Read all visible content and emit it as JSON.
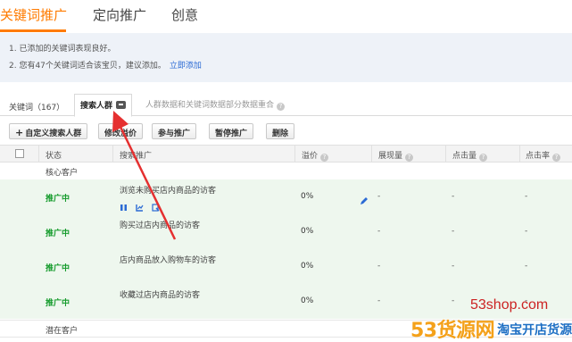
{
  "topnav": {
    "tabs": [
      {
        "label": "关键词推广",
        "active": true
      },
      {
        "label": "定向推广",
        "active": false
      },
      {
        "label": "创意",
        "active": false
      }
    ]
  },
  "tips": {
    "line1": "1. 已添加的关键词表现良好。",
    "line2": "2. 您有47个关键词适合该宝贝，建议添加。",
    "line2_link": "立即添加"
  },
  "subtabs": {
    "keywords": "关键词（167）",
    "crowd": "搜索人群",
    "hint": "人群数据和关键词数据部分数据重合"
  },
  "toolbar": {
    "custom": "自定义搜索人群",
    "edit_bid": "修改溢价",
    "join": "参与推广",
    "pause": "暂停推广",
    "delete": "删除"
  },
  "table": {
    "headers": {
      "status": "状态",
      "crowd": "搜索推广",
      "premium": "溢价",
      "impressions": "展现量",
      "clicks": "点击量",
      "ctr": "点击率"
    },
    "group_core": "核心客户",
    "group_potential": "潜在客户",
    "rows": [
      {
        "status": "推广中",
        "name": "浏览未购买店内商品的访客",
        "premium": "0%",
        "impressions": "-",
        "clicks": "-",
        "ctr": "-"
      },
      {
        "status": "推广中",
        "name": "购买过店内商品的访客",
        "premium": "0%",
        "impressions": "-",
        "clicks": "-",
        "ctr": "-"
      },
      {
        "status": "推广中",
        "name": "店内商品放入购物车的访客",
        "premium": "0%",
        "impressions": "-",
        "clicks": "-",
        "ctr": "-"
      },
      {
        "status": "推广中",
        "name": "收藏过店内商品的访客",
        "premium": "0%",
        "impressions": "-",
        "clicks": "-",
        "ctr": "-"
      }
    ]
  },
  "watermark": {
    "site": "53shop.com",
    "brand": "53货源网",
    "slogan": "淘宝开店货源"
  },
  "colors": {
    "accent": "#ff7b00",
    "status_green": "#159b2c",
    "link_blue": "#2a6ad4",
    "arrow_red": "#e53030"
  }
}
